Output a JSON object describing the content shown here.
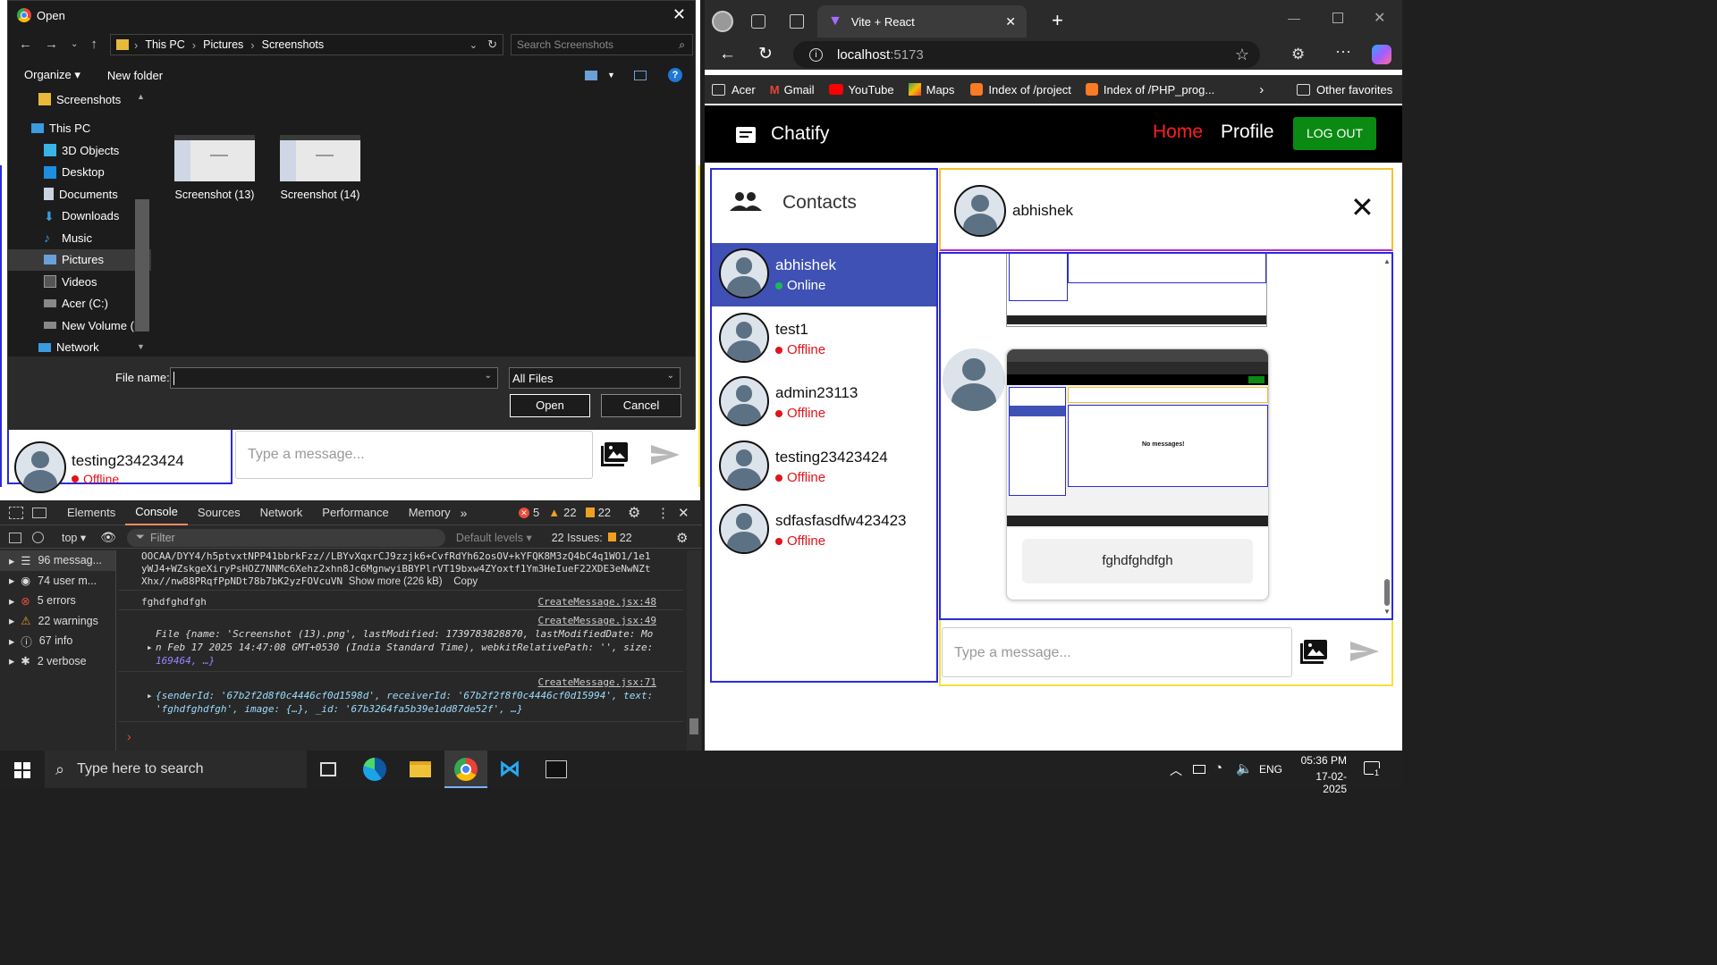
{
  "dialog": {
    "title": "Open",
    "breadcrumb": [
      "This PC",
      "Pictures",
      "Screenshots"
    ],
    "search_placeholder": "Search Screenshots",
    "organize_label": "Organize",
    "new_folder_label": "New folder",
    "nav_items": [
      "Screenshots",
      "This PC",
      "3D Objects",
      "Desktop",
      "Documents",
      "Downloads",
      "Music",
      "Pictures",
      "Videos",
      "Acer (C:)",
      "New Volume (D:",
      "Network"
    ],
    "files": [
      "Screenshot (13)",
      "Screenshot (14)"
    ],
    "file_name_label": "File name:",
    "file_name_value": "",
    "filter_value": "All Files",
    "open_label": "Open",
    "cancel_label": "Cancel"
  },
  "background_app": {
    "contact_name": "testing23423424",
    "contact_status": "Offline",
    "message_placeholder": "Type a message..."
  },
  "devtools": {
    "tabs": [
      "Elements",
      "Console",
      "Sources",
      "Network",
      "Performance",
      "Memory"
    ],
    "active_tab": "Console",
    "error_count": "5",
    "warning_count": "22",
    "issue_count": "22",
    "context": "top",
    "filter_placeholder": "Filter",
    "levels_label": "Default levels",
    "issues_label": "22 Issues:",
    "issues_badge": "22",
    "sidebar": [
      "96 messag...",
      "74 user m...",
      "5 errors",
      "22 warnings",
      "67 info",
      "2 verbose"
    ],
    "log": {
      "base64_line1": "OOCAA/DYY4/h5ptvxtNPP41bbrkFzz//LBYvXqxrCJ9zzjk6+CvfRdYh62osOV+kYFQK8M3zQ4bC4q1WO1/1e1",
      "base64_line2": "yWJ4+WZskgeXiryPsHOZ7NNMc6Xehz2xhn8Jc6MgnwyiBBYPlrVT19bxw4ZYoxtf1Ym3HeIueF22XDE3eNwNZt",
      "base64_line3": "Xhx//nw88PRqfPpNDt78b7bK2yzFOVcuVN",
      "show_more": "Show more (226 kB)",
      "copy": "Copy",
      "line2_text": "fghdfghdfgh",
      "line2_src": "CreateMessage.jsx:48",
      "line3_src": "CreateMessage.jsx:49",
      "line3_a": "File {name: 'Screenshot (13).png', lastModified: 1739783828870, lastModifiedDate: Mo",
      "line3_b": "n Feb 17 2025 14:47:08 GMT+0530 (India Standard Time), webkitRelativePath: '', size:",
      "line3_c": "169464, …}",
      "line4_src": "CreateMessage.jsx:71",
      "line4_a": "{senderId: '67b2f2d8f0c4446cf0d1598d', receiverId: '67b2f2f8f0c4446cf0d15994', text:",
      "line4_b": "'fghdfghdfgh', image: {…}, _id: '67b3264fa5b39e1dd87de52f', …}"
    }
  },
  "browser": {
    "tab_title": "Vite + React",
    "url_host": "localhost",
    "url_port": ":5173",
    "bookmarks": [
      "Acer",
      "Gmail",
      "YouTube",
      "Maps",
      "Index of /project",
      "Index of /PHP_prog..."
    ],
    "other_favorites": "Other favorites"
  },
  "chat": {
    "brand": "Chatify",
    "nav_home": "Home",
    "nav_profile": "Profile",
    "logout": "LOG OUT",
    "contacts_title": "Contacts",
    "contacts": [
      {
        "name": "abhishek",
        "status": "Online"
      },
      {
        "name": "test1",
        "status": "Offline"
      },
      {
        "name": "admin23113",
        "status": "Offline"
      },
      {
        "name": "testing23423424",
        "status": "Offline"
      },
      {
        "name": "sdfasfasdfw423423",
        "status": "Offline"
      }
    ],
    "active_chat_name": "abhishek",
    "message_caption": "fghdfghdfgh",
    "message_placeholder": "Type a message...",
    "thumb_no_messages": "No messages!",
    "colors": {
      "online": "#1db954",
      "offline": "#e0141b",
      "active_bg": "#3f51b5",
      "logout_bg": "#0a8a12",
      "home": "#ff1e1e"
    }
  },
  "taskbar": {
    "search_placeholder": "Type here to search",
    "lang": "ENG",
    "time": "05:36 PM",
    "date": "17-02-2025",
    "notif_count": "1"
  }
}
